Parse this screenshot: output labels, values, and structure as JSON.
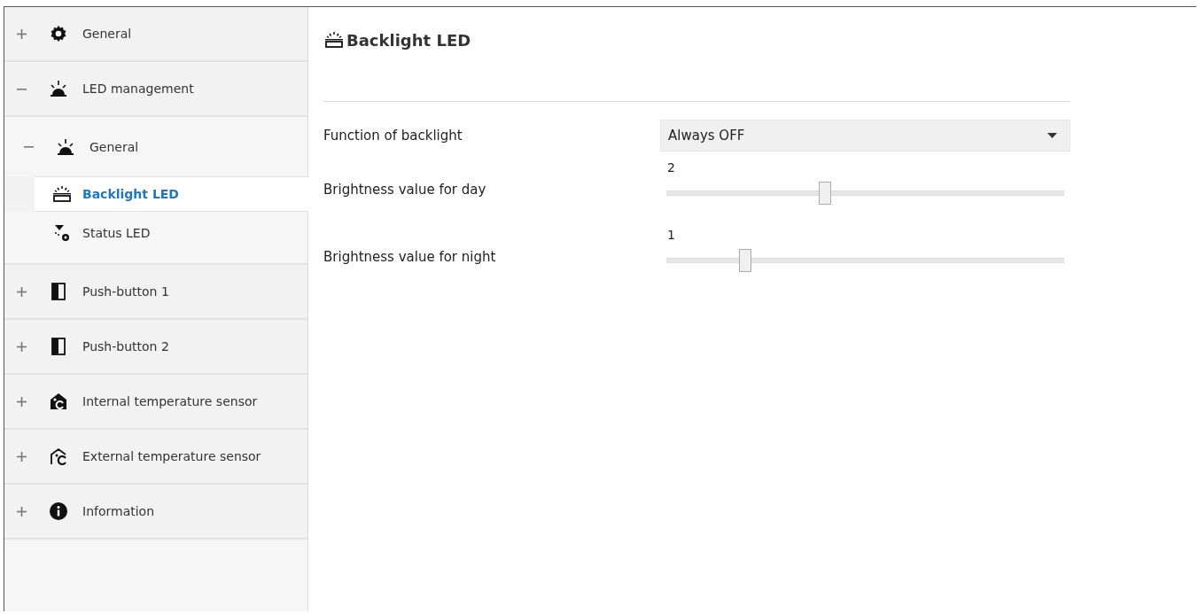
{
  "sidebar": {
    "items": [
      {
        "label": "General",
        "kind": "gear",
        "expanded": false,
        "selected": false
      },
      {
        "label": "LED management",
        "kind": "led",
        "expanded": true,
        "selected": false,
        "children": [
          {
            "label": "General",
            "kind": "led",
            "expanded": true,
            "selected": false,
            "children": [
              {
                "label": "Backlight LED",
                "kind": "backlight",
                "selected": true
              },
              {
                "label": "Status LED",
                "kind": "status",
                "selected": false
              }
            ]
          }
        ]
      },
      {
        "label": "Push-button 1",
        "kind": "button",
        "expanded": false,
        "selected": false
      },
      {
        "label": "Push-button 2",
        "kind": "button",
        "expanded": false,
        "selected": false
      },
      {
        "label": "Internal temperature sensor",
        "kind": "internal",
        "expanded": false,
        "selected": false
      },
      {
        "label": "External temperature sensor",
        "kind": "external",
        "expanded": false,
        "selected": false
      },
      {
        "label": "Information",
        "kind": "info",
        "expanded": false,
        "selected": false
      }
    ]
  },
  "panel": {
    "title": "Backlight LED",
    "params": [
      {
        "kind": "dropdown",
        "label": "Function of backlight",
        "value": "Always OFF"
      },
      {
        "kind": "slider",
        "label": "Brightness value for day",
        "reading": "2",
        "level": 0.4
      },
      {
        "kind": "slider",
        "label": "Brightness value for night",
        "reading": "1",
        "level": 0.2
      }
    ]
  }
}
